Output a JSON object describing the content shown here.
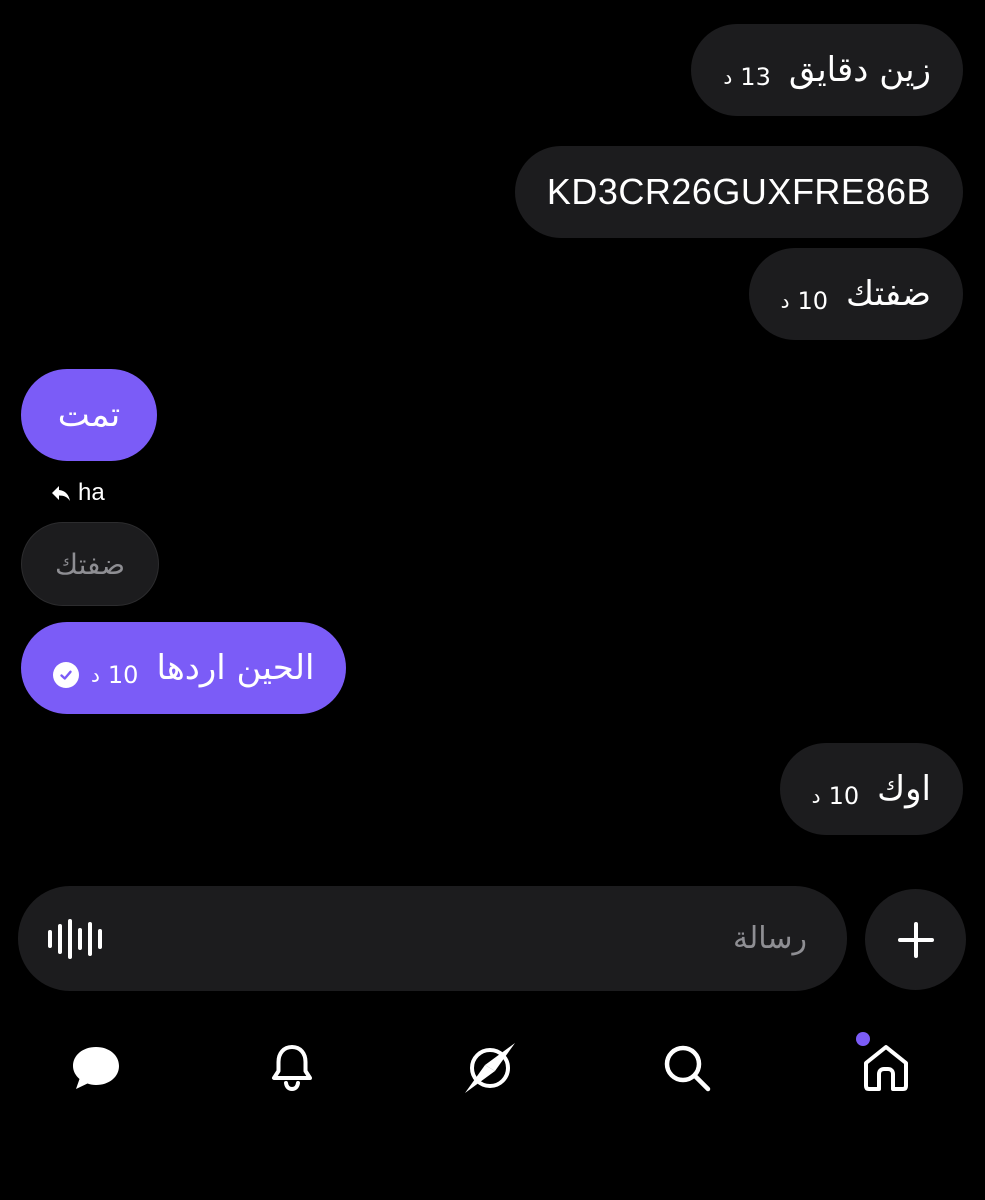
{
  "colors": {
    "background": "#000000",
    "received_bubble": "#1c1c1e",
    "sent_bubble": "#7b5cf7",
    "accent": "#7b5cf7",
    "muted_text": "#8e8e93"
  },
  "messages": [
    {
      "direction": "received",
      "text": "زين دقايق",
      "time": "13",
      "time_unit": "د"
    },
    {
      "direction": "received",
      "text": "KD3CR26GUXFRE86B"
    },
    {
      "direction": "received",
      "text": "ضفتك",
      "time": "10",
      "time_unit": "د"
    },
    {
      "direction": "sent",
      "text": "تمت"
    },
    {
      "direction": "sent",
      "text": "الحين اردها",
      "time": "10",
      "time_unit": "د",
      "status": "read-check-icon"
    },
    {
      "direction": "received",
      "text": "اوك",
      "time": "10",
      "time_unit": "د"
    }
  ],
  "reply": {
    "icon": "reply-arrow-icon",
    "label": "ha",
    "quoted_text": "ضفتك"
  },
  "composer": {
    "placeholder": "رسالة",
    "value": "",
    "voice_icon": "waveform-icon",
    "attach_icon": "plus-icon"
  },
  "bottom_nav": [
    {
      "name": "chat",
      "icon": "chat-bubble-icon"
    },
    {
      "name": "notifications",
      "icon": "bell-icon"
    },
    {
      "name": "explore",
      "icon": "explore-compass-icon"
    },
    {
      "name": "search",
      "icon": "search-icon"
    },
    {
      "name": "home",
      "icon": "home-icon",
      "badge": "unread-dot"
    }
  ]
}
